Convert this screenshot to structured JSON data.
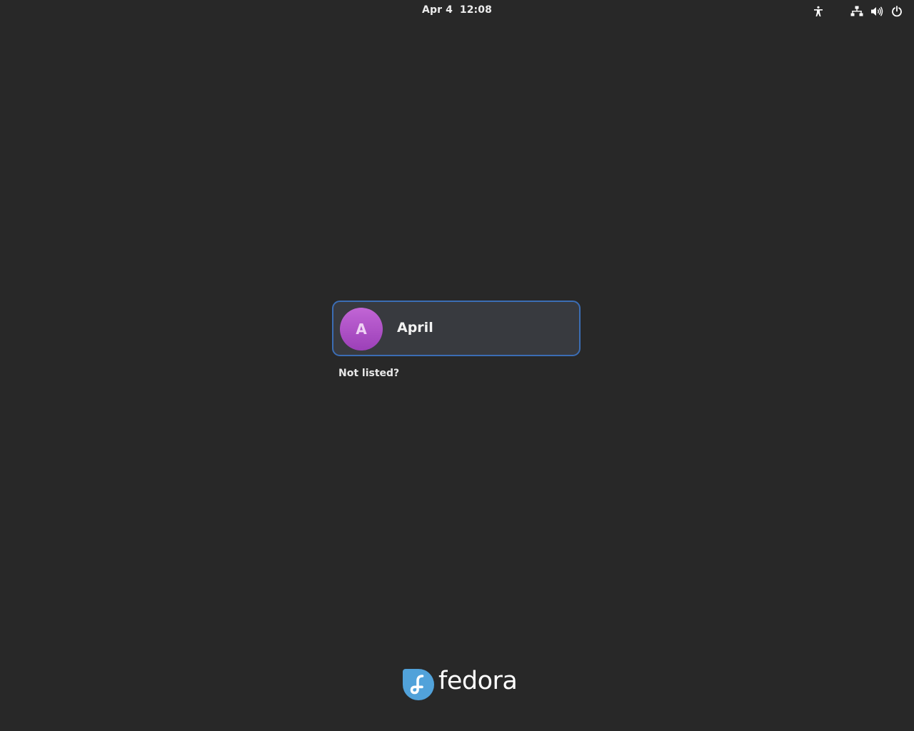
{
  "topbar": {
    "clock": "Apr 4  12:08",
    "icons": {
      "accessibility": "accessibility-icon",
      "network": "network-wired-icon",
      "volume": "volume-icon",
      "power": "power-icon"
    }
  },
  "login": {
    "users": [
      {
        "name": "April",
        "initial": "A",
        "avatar_color": "#b255cb"
      }
    ],
    "focus_color": "#3b6db4",
    "not_listed_label": "Not listed?"
  },
  "branding": {
    "logo_text": "fedora",
    "logo_color": "#51a2da"
  }
}
